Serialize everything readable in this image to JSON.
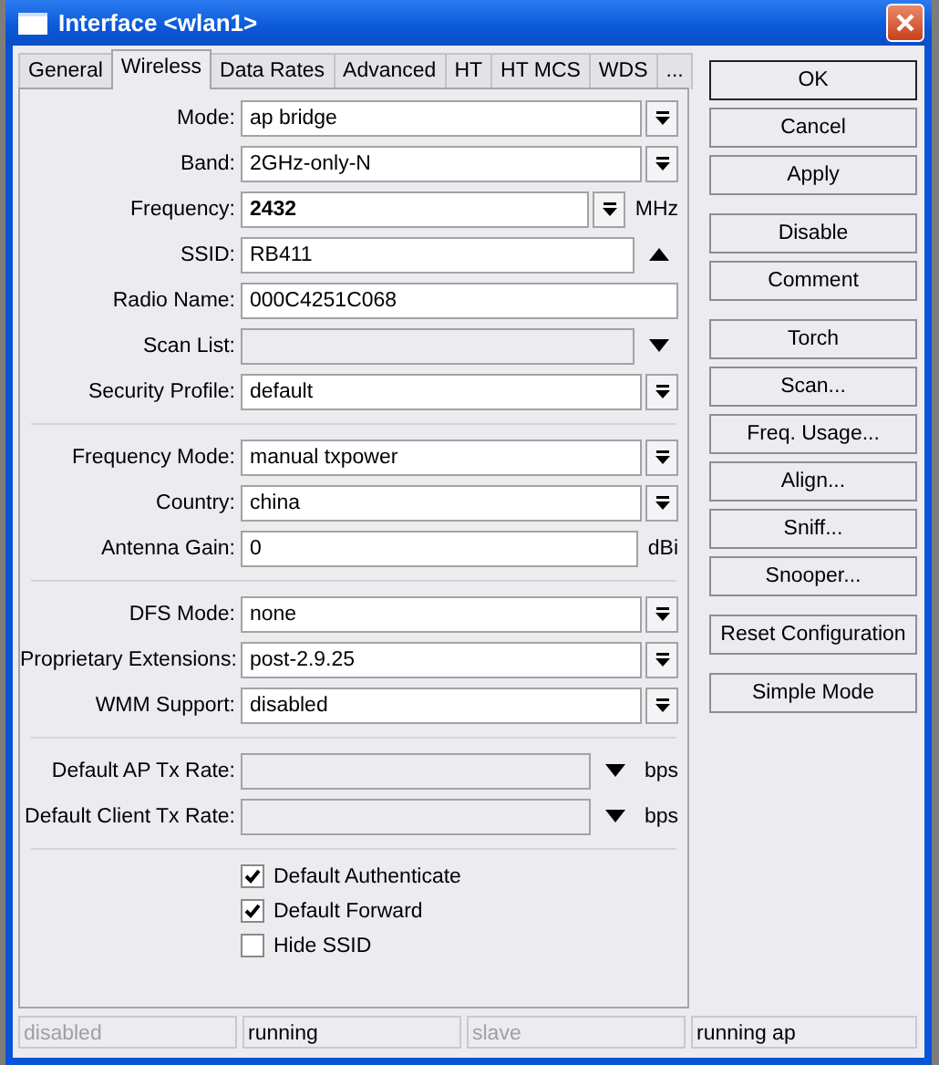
{
  "window": {
    "title": "Interface <wlan1>"
  },
  "tabs": [
    {
      "label": "General",
      "selected": false
    },
    {
      "label": "Wireless",
      "selected": true
    },
    {
      "label": "Data Rates",
      "selected": false
    },
    {
      "label": "Advanced",
      "selected": false
    },
    {
      "label": "HT",
      "selected": false
    },
    {
      "label": "HT MCS",
      "selected": false
    },
    {
      "label": "WDS",
      "selected": false
    },
    {
      "label": "...",
      "selected": false
    }
  ],
  "sections": [
    {
      "fields": [
        {
          "kind": "select",
          "label": "Mode:",
          "value": "ap bridge",
          "disabled": false,
          "bold": false
        },
        {
          "kind": "select",
          "label": "Band:",
          "value": "2GHz-only-N",
          "disabled": false,
          "bold": false
        },
        {
          "kind": "select",
          "label": "Frequency:",
          "value": "2432",
          "unit": "MHz",
          "disabled": false,
          "bold": true
        },
        {
          "kind": "collapse",
          "label": "SSID:",
          "value": "RB411",
          "disabled": false,
          "bold": false
        },
        {
          "kind": "input",
          "label": "Radio Name:",
          "value": "000C4251C068",
          "disabled": false,
          "bold": false
        },
        {
          "kind": "dropdown",
          "label": "Scan List:",
          "disabled": true
        },
        {
          "kind": "select",
          "label": "Security Profile:",
          "value": "default",
          "disabled": false,
          "bold": false
        }
      ]
    },
    {
      "fields": [
        {
          "kind": "select",
          "label": "Frequency Mode:",
          "value": "manual txpower",
          "disabled": false,
          "bold": false
        },
        {
          "kind": "select",
          "label": "Country:",
          "value": "china",
          "disabled": false,
          "bold": false
        },
        {
          "kind": "input",
          "label": "Antenna Gain:",
          "value": "0",
          "unit": "dBi",
          "disabled": false,
          "bold": false
        }
      ]
    },
    {
      "fields": [
        {
          "kind": "select",
          "label": "DFS Mode:",
          "value": "none",
          "disabled": false,
          "bold": false
        },
        {
          "kind": "select",
          "label": "Proprietary Extensions:",
          "value": "post-2.9.25",
          "disabled": false,
          "bold": false
        },
        {
          "kind": "select",
          "label": "WMM Support:",
          "value": "disabled",
          "disabled": false,
          "bold": false
        }
      ]
    },
    {
      "fields": [
        {
          "kind": "dropdown",
          "label": "Default AP Tx Rate:",
          "unit": "bps",
          "disabled": true
        },
        {
          "kind": "dropdown",
          "label": "Default Client Tx Rate:",
          "unit": "bps",
          "disabled": true
        }
      ]
    },
    {
      "checkboxes": [
        {
          "label": "Default Authenticate",
          "checked": true
        },
        {
          "label": "Default Forward",
          "checked": true
        },
        {
          "label": "Hide SSID",
          "checked": false
        }
      ]
    }
  ],
  "button_groups": [
    {
      "buttons": [
        {
          "label": "OK",
          "default": true
        },
        {
          "label": "Cancel",
          "default": false
        },
        {
          "label": "Apply",
          "default": false
        }
      ]
    },
    {
      "buttons": [
        {
          "label": "Disable",
          "default": false
        },
        {
          "label": "Comment",
          "default": false
        }
      ]
    },
    {
      "buttons": [
        {
          "label": "Torch",
          "default": false
        },
        {
          "label": "Scan...",
          "default": false
        },
        {
          "label": "Freq. Usage...",
          "default": false
        },
        {
          "label": "Align...",
          "default": false
        },
        {
          "label": "Sniff...",
          "default": false
        },
        {
          "label": "Snooper...",
          "default": false
        }
      ]
    },
    {
      "buttons": [
        {
          "label": "Reset Configuration",
          "default": false
        }
      ]
    },
    {
      "buttons": [
        {
          "label": "Simple Mode",
          "default": false
        }
      ]
    }
  ],
  "status_bar": [
    {
      "text": "disabled",
      "active": false
    },
    {
      "text": "running",
      "active": true
    },
    {
      "text": "slave",
      "active": false
    },
    {
      "text": "running ap",
      "active": true
    }
  ]
}
